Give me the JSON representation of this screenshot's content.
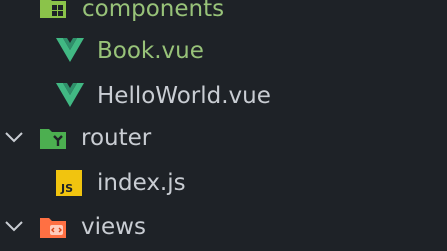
{
  "explorer": {
    "items": [
      {
        "label": "components",
        "kind": "folder",
        "icon": "folder-components-icon",
        "expanded": true,
        "color": "#98c379"
      },
      {
        "label": "Book.vue",
        "kind": "file",
        "icon": "vue-file-icon",
        "color": "#98c379"
      },
      {
        "label": "HelloWorld.vue",
        "kind": "file",
        "icon": "vue-file-icon",
        "color": "#c9cdd3"
      },
      {
        "label": "router",
        "kind": "folder",
        "icon": "folder-router-icon",
        "expanded": true,
        "color": "#c9cdd3"
      },
      {
        "label": "index.js",
        "kind": "file",
        "icon": "js-file-icon",
        "color": "#c9cdd3"
      },
      {
        "label": "views",
        "kind": "folder",
        "icon": "folder-views-icon",
        "expanded": true,
        "color": "#c9cdd3"
      }
    ]
  },
  "colors": {
    "background": "#1e2227",
    "vue": "#41b883",
    "js_badge": "#f1c40f",
    "folder_components": "#8bc34a",
    "folder_router": "#4caf50",
    "folder_views": "#ff7043"
  }
}
